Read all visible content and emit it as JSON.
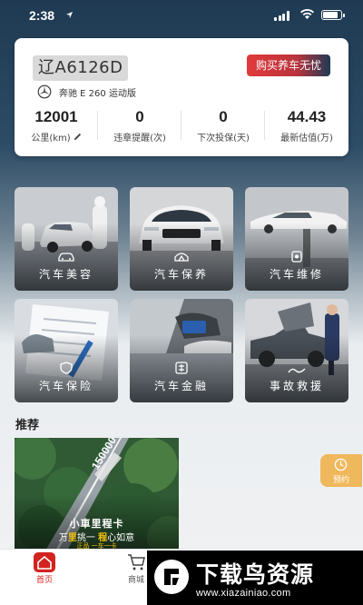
{
  "status_bar": {
    "time": "2:38",
    "location_icon": "location-arrow-icon"
  },
  "vehicle": {
    "plate": "辽A6126D",
    "model": "奔驰 E 260 运动版",
    "buy_button": "购买养车无忧",
    "brand_icon": "mercedes-logo-icon"
  },
  "stats": [
    {
      "value": "12001",
      "label": "公里(km)"
    },
    {
      "value": "0",
      "label": "违章提醒(次)"
    },
    {
      "value": "0",
      "label": "下次投保(天)"
    },
    {
      "value": "44.43",
      "label": "最新估值(万)"
    }
  ],
  "services": [
    {
      "label": "汽车美容",
      "icon": "car-wash-icon"
    },
    {
      "label": "汽车保养",
      "icon": "car-service-icon"
    },
    {
      "label": "汽车维修",
      "icon": "car-repair-icon"
    },
    {
      "label": "汽车保险",
      "icon": "insurance-shield-icon"
    },
    {
      "label": "汽车金融",
      "icon": "finance-coin-icon"
    },
    {
      "label": "事故救援",
      "icon": "rescue-tow-icon"
    }
  ],
  "recommend": {
    "title": "推荐",
    "banner": {
      "title": "小車里程卡",
      "slogan_a": "万",
      "slogan_b": "里",
      "slogan_c": "挑一 ",
      "slogan_d": "程",
      "slogan_e": "心如意",
      "sub": "正品  一车一卡",
      "odometer": "150000"
    }
  },
  "reserve_button": "预约",
  "tabs": [
    {
      "label": "首页",
      "active": true
    },
    {
      "label": "商城",
      "active": false
    }
  ],
  "watermark": {
    "title": "下载鸟资源",
    "url": "www.xiazainiao.com"
  },
  "colors": {
    "accent": "#d3231f",
    "reserve": "#f0b85c",
    "header_bg": "#1f3a52"
  }
}
